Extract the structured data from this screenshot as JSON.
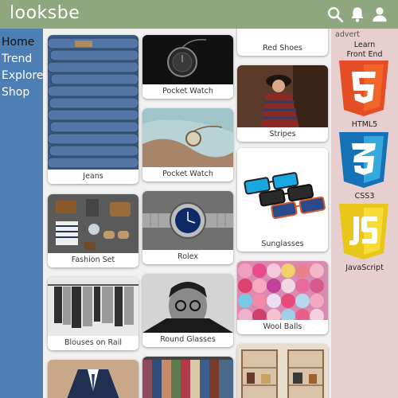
{
  "header": {
    "logo": "looksbe",
    "icons": [
      "search-icon",
      "bell-icon",
      "user-icon"
    ],
    "color": "#8fa77f"
  },
  "sidebar": {
    "color": "#4e7fb4",
    "items": [
      {
        "label": "Home",
        "active": true
      },
      {
        "label": "Trend",
        "active": false
      },
      {
        "label": "Explore",
        "active": false
      },
      {
        "label": "Shop",
        "active": false
      }
    ]
  },
  "feed": {
    "cards": [
      {
        "caption": "Jeans"
      },
      {
        "caption": "Pocket Watch"
      },
      {
        "caption": "Pocket Watch"
      },
      {
        "caption": "Red Shoes"
      },
      {
        "caption": "Stripes"
      },
      {
        "caption": "Sunglasses"
      },
      {
        "caption": "Fashion Set"
      },
      {
        "caption": "Rolex"
      },
      {
        "caption": "Blouses on Rail"
      },
      {
        "caption": "Round Glasses"
      },
      {
        "caption": "Wool Balls"
      }
    ]
  },
  "advert": {
    "label": "advert",
    "title_line1": "Learn",
    "title_line2": "Front End",
    "items": [
      {
        "name": "HTML5",
        "digit": "5",
        "color": "#e44d26"
      },
      {
        "name": "CSS3",
        "digit": "3",
        "color": "#1f73b8"
      },
      {
        "name": "JavaScript",
        "digit": "JS",
        "color": "#f0d51c"
      }
    ],
    "background": "#e7cfcf"
  }
}
